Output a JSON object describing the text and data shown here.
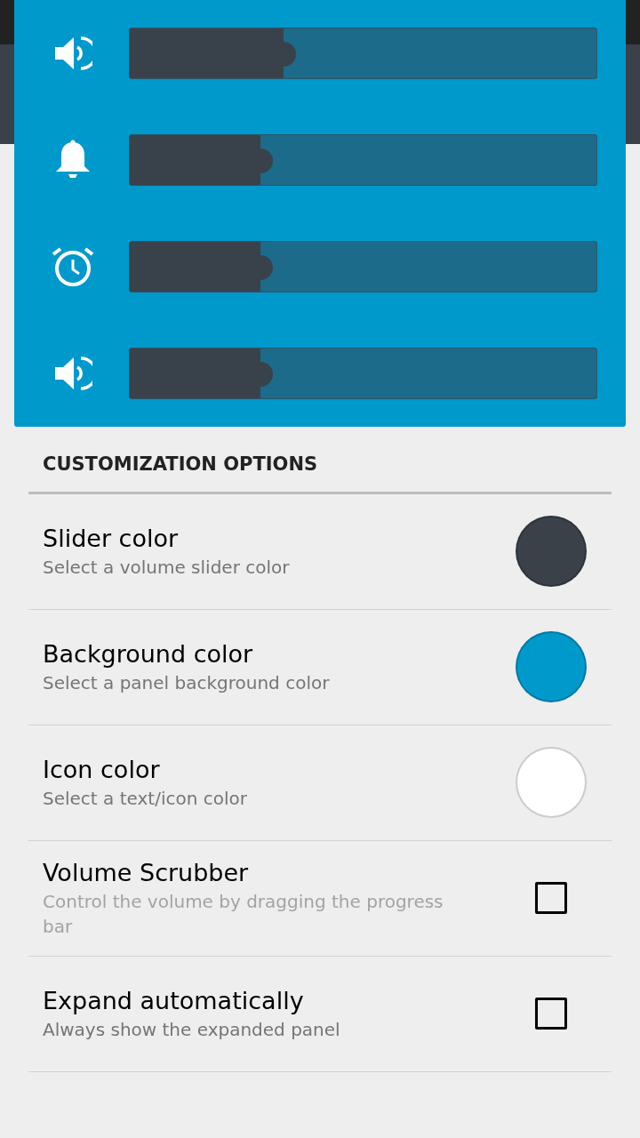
{
  "volume_panel": {
    "sliders": [
      {
        "kind": "media",
        "level": 0.33
      },
      {
        "kind": "ringer",
        "level": 0.28
      },
      {
        "kind": "alarm",
        "level": 0.28
      },
      {
        "kind": "media",
        "level": 0.28
      }
    ]
  },
  "section_title": "CUSTOMIZATION OPTIONS",
  "options": [
    {
      "kind": "color",
      "title": "Slider color",
      "description": "Select a volume slider color",
      "color": "#3a4149"
    },
    {
      "kind": "color",
      "title": "Background color",
      "description": "Select a panel background color",
      "color": "#0099cc"
    },
    {
      "kind": "color",
      "title": "Icon color",
      "description": "Select a text/icon color",
      "color": "#ffffff"
    },
    {
      "kind": "checkbox",
      "title": "Volume Scrubber",
      "description": "Control the volume by dragging the progress bar",
      "checked": false,
      "disabled": true
    },
    {
      "kind": "checkbox",
      "title": "Expand automatically",
      "description": "Always show the expanded panel",
      "checked": false,
      "disabled": false
    }
  ]
}
